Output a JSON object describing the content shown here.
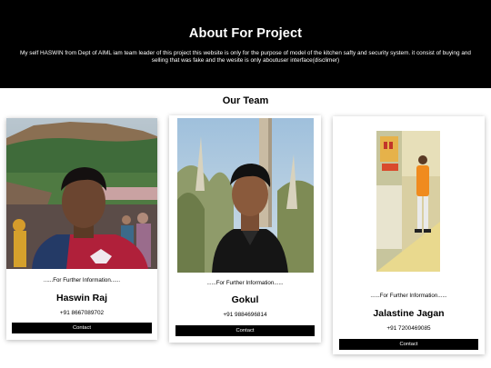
{
  "hero": {
    "title": "About For Project",
    "description": "My self HASWIN from Dept of AIML iam team leader of this project this website is only for the purpose of model of the kitchen safty and security system. it consist of buying and selling that was fake and the wesite is only aboutuser interface(disclimer)"
  },
  "team": {
    "title": "Our Team",
    "members": [
      {
        "info": "......For Further Information......",
        "name": "Haswin Raj",
        "phone": "+91 8667089702",
        "contact_label": "Contact"
      },
      {
        "info": "......For Further Information......",
        "name": "Gokul",
        "phone": "+91 9884696814",
        "contact_label": "Contact"
      },
      {
        "info": "......For Further Information......",
        "name": "Jalastine Jagan",
        "phone": "+91 7200469085",
        "contact_label": "Contact"
      }
    ]
  },
  "colors": {
    "header_bg": "#000000",
    "header_text": "#ffffff",
    "button_bg": "#000000",
    "button_text": "#ffffff"
  }
}
